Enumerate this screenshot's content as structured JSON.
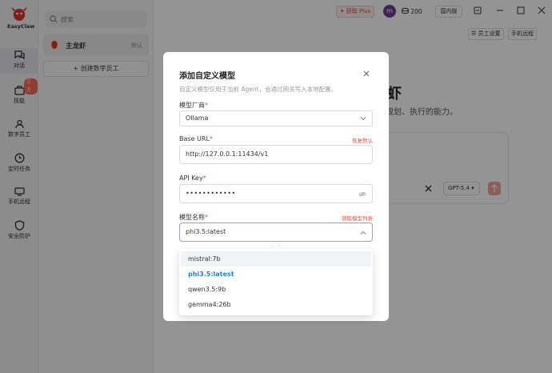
{
  "rail": {
    "logo_text": "EasyClaw",
    "items": [
      {
        "label": "对话",
        "icon": "chat-icon"
      },
      {
        "label": "技能",
        "icon": "skills-icon",
        "badge": "三方"
      },
      {
        "label": "数字员工",
        "icon": "digital-employee-icon"
      },
      {
        "label": "定时任务",
        "icon": "clock-icon"
      },
      {
        "label": "手机远程",
        "icon": "phone-remote-icon"
      },
      {
        "label": "安全防护",
        "icon": "shield-icon"
      }
    ]
  },
  "sidebar": {
    "search_placeholder": "搜索",
    "employee": {
      "name": "主龙虾",
      "tag": "默认"
    },
    "create_label": "+ 创建数字员工"
  },
  "topbar": {
    "plus_label": "获取 Plus",
    "avatar_letter": "m",
    "coins": "200",
    "region": "国内版",
    "staff_settings": "员工设置",
    "phone_remote": "手机远程"
  },
  "background": {
    "title": "虾",
    "subtitle": "规划、执行的能力。",
    "model_select": "GPT-5.4"
  },
  "modal": {
    "title": "添加自定义模型",
    "description": "自定义模型仅用于当前 Agent，会通过网关写入本地配置。",
    "vendor": {
      "label": "模型厂商",
      "value": "Ollama"
    },
    "base_url": {
      "label": "Base URL",
      "link": "恢复默认",
      "value": "http://127.0.0.1:11434/v1"
    },
    "api_key": {
      "label": "API Key",
      "value": "••••••••••••"
    },
    "model_name": {
      "label": "模型名称",
      "link": "获取模型列表",
      "value": "phi3.5:latest"
    },
    "required_mark": "*"
  },
  "dropdown": {
    "options": [
      "mistral:7b",
      "phi3.5:latest",
      "qwen3.5:9b",
      "gemma4:26b"
    ],
    "selected": "phi3.5:latest",
    "hovered": "mistral:7b"
  },
  "colors": {
    "accent": "#e0503f",
    "link_blue": "#1e82e0",
    "avatar": "#6c3d8e"
  }
}
